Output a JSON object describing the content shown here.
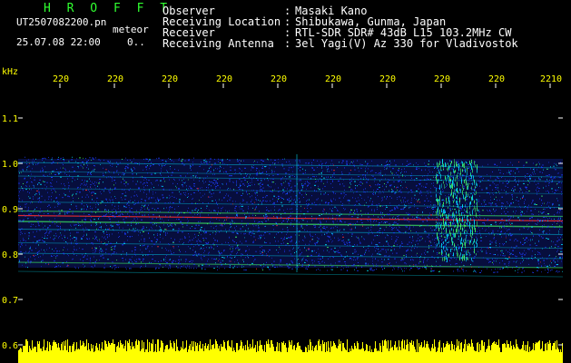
{
  "header": {
    "brand": "H R O F F T",
    "file_name": "UT2507082200.pn",
    "mode": "meteor",
    "timestamp": "25.07.08 22:00",
    "fraction": "0.."
  },
  "station_info": [
    {
      "label": "Observer",
      "value": "Masaki Kano"
    },
    {
      "label": "Receiving Location",
      "value": "Shibukawa, Gunma, Japan"
    },
    {
      "label": "Receiver",
      "value": "RTL-SDR SDR# 43dB L15 103.2MHz CW"
    },
    {
      "label": "Receiving Antenna",
      "value": "3el Yagi(V) Az 330 for Vladivostok"
    }
  ],
  "axis": {
    "unit": "kHz",
    "x_ticks": [
      "220",
      "220",
      "220",
      "220",
      "220",
      "220",
      "220",
      "220",
      "220",
      "2210"
    ],
    "y_ticks": [
      "1.1",
      "1.0",
      "0.9",
      "0.8",
      "0.7",
      "0.6"
    ],
    "y_range": [
      0.6,
      1.1
    ]
  },
  "colors": {
    "background": "#000000",
    "text_yellow": "#ffff00",
    "text_green": "#30ff30",
    "tick_white": "#ffffff",
    "noise_blue": "#1e3cff",
    "signal_cyan": "#00e5ff",
    "signal_green": "#44ff66",
    "signal_red": "#ff3030",
    "meter_yellow": "#ffff00"
  }
}
